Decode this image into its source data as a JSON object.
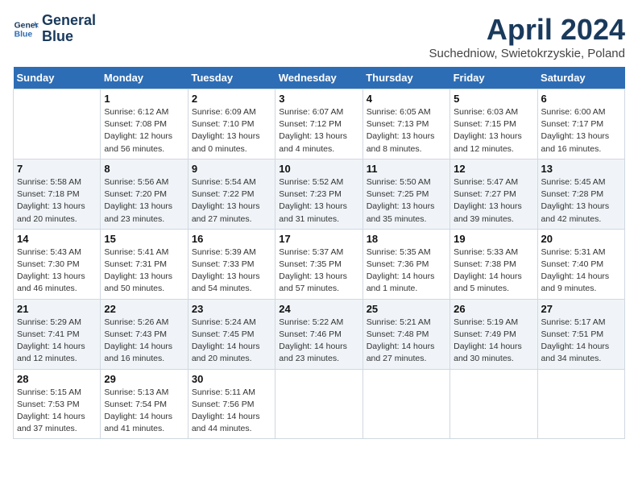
{
  "header": {
    "logo_line1": "General",
    "logo_line2": "Blue",
    "title": "April 2024",
    "subtitle": "Suchedniow, Swietokrzyskie, Poland"
  },
  "days_of_week": [
    "Sunday",
    "Monday",
    "Tuesday",
    "Wednesday",
    "Thursday",
    "Friday",
    "Saturday"
  ],
  "weeks": [
    [
      {
        "num": "",
        "info": ""
      },
      {
        "num": "1",
        "info": "Sunrise: 6:12 AM\nSunset: 7:08 PM\nDaylight: 12 hours\nand 56 minutes."
      },
      {
        "num": "2",
        "info": "Sunrise: 6:09 AM\nSunset: 7:10 PM\nDaylight: 13 hours\nand 0 minutes."
      },
      {
        "num": "3",
        "info": "Sunrise: 6:07 AM\nSunset: 7:12 PM\nDaylight: 13 hours\nand 4 minutes."
      },
      {
        "num": "4",
        "info": "Sunrise: 6:05 AM\nSunset: 7:13 PM\nDaylight: 13 hours\nand 8 minutes."
      },
      {
        "num": "5",
        "info": "Sunrise: 6:03 AM\nSunset: 7:15 PM\nDaylight: 13 hours\nand 12 minutes."
      },
      {
        "num": "6",
        "info": "Sunrise: 6:00 AM\nSunset: 7:17 PM\nDaylight: 13 hours\nand 16 minutes."
      }
    ],
    [
      {
        "num": "7",
        "info": "Sunrise: 5:58 AM\nSunset: 7:18 PM\nDaylight: 13 hours\nand 20 minutes."
      },
      {
        "num": "8",
        "info": "Sunrise: 5:56 AM\nSunset: 7:20 PM\nDaylight: 13 hours\nand 23 minutes."
      },
      {
        "num": "9",
        "info": "Sunrise: 5:54 AM\nSunset: 7:22 PM\nDaylight: 13 hours\nand 27 minutes."
      },
      {
        "num": "10",
        "info": "Sunrise: 5:52 AM\nSunset: 7:23 PM\nDaylight: 13 hours\nand 31 minutes."
      },
      {
        "num": "11",
        "info": "Sunrise: 5:50 AM\nSunset: 7:25 PM\nDaylight: 13 hours\nand 35 minutes."
      },
      {
        "num": "12",
        "info": "Sunrise: 5:47 AM\nSunset: 7:27 PM\nDaylight: 13 hours\nand 39 minutes."
      },
      {
        "num": "13",
        "info": "Sunrise: 5:45 AM\nSunset: 7:28 PM\nDaylight: 13 hours\nand 42 minutes."
      }
    ],
    [
      {
        "num": "14",
        "info": "Sunrise: 5:43 AM\nSunset: 7:30 PM\nDaylight: 13 hours\nand 46 minutes."
      },
      {
        "num": "15",
        "info": "Sunrise: 5:41 AM\nSunset: 7:31 PM\nDaylight: 13 hours\nand 50 minutes."
      },
      {
        "num": "16",
        "info": "Sunrise: 5:39 AM\nSunset: 7:33 PM\nDaylight: 13 hours\nand 54 minutes."
      },
      {
        "num": "17",
        "info": "Sunrise: 5:37 AM\nSunset: 7:35 PM\nDaylight: 13 hours\nand 57 minutes."
      },
      {
        "num": "18",
        "info": "Sunrise: 5:35 AM\nSunset: 7:36 PM\nDaylight: 14 hours\nand 1 minute."
      },
      {
        "num": "19",
        "info": "Sunrise: 5:33 AM\nSunset: 7:38 PM\nDaylight: 14 hours\nand 5 minutes."
      },
      {
        "num": "20",
        "info": "Sunrise: 5:31 AM\nSunset: 7:40 PM\nDaylight: 14 hours\nand 9 minutes."
      }
    ],
    [
      {
        "num": "21",
        "info": "Sunrise: 5:29 AM\nSunset: 7:41 PM\nDaylight: 14 hours\nand 12 minutes."
      },
      {
        "num": "22",
        "info": "Sunrise: 5:26 AM\nSunset: 7:43 PM\nDaylight: 14 hours\nand 16 minutes."
      },
      {
        "num": "23",
        "info": "Sunrise: 5:24 AM\nSunset: 7:45 PM\nDaylight: 14 hours\nand 20 minutes."
      },
      {
        "num": "24",
        "info": "Sunrise: 5:22 AM\nSunset: 7:46 PM\nDaylight: 14 hours\nand 23 minutes."
      },
      {
        "num": "25",
        "info": "Sunrise: 5:21 AM\nSunset: 7:48 PM\nDaylight: 14 hours\nand 27 minutes."
      },
      {
        "num": "26",
        "info": "Sunrise: 5:19 AM\nSunset: 7:49 PM\nDaylight: 14 hours\nand 30 minutes."
      },
      {
        "num": "27",
        "info": "Sunrise: 5:17 AM\nSunset: 7:51 PM\nDaylight: 14 hours\nand 34 minutes."
      }
    ],
    [
      {
        "num": "28",
        "info": "Sunrise: 5:15 AM\nSunset: 7:53 PM\nDaylight: 14 hours\nand 37 minutes."
      },
      {
        "num": "29",
        "info": "Sunrise: 5:13 AM\nSunset: 7:54 PM\nDaylight: 14 hours\nand 41 minutes."
      },
      {
        "num": "30",
        "info": "Sunrise: 5:11 AM\nSunset: 7:56 PM\nDaylight: 14 hours\nand 44 minutes."
      },
      {
        "num": "",
        "info": ""
      },
      {
        "num": "",
        "info": ""
      },
      {
        "num": "",
        "info": ""
      },
      {
        "num": "",
        "info": ""
      }
    ]
  ]
}
